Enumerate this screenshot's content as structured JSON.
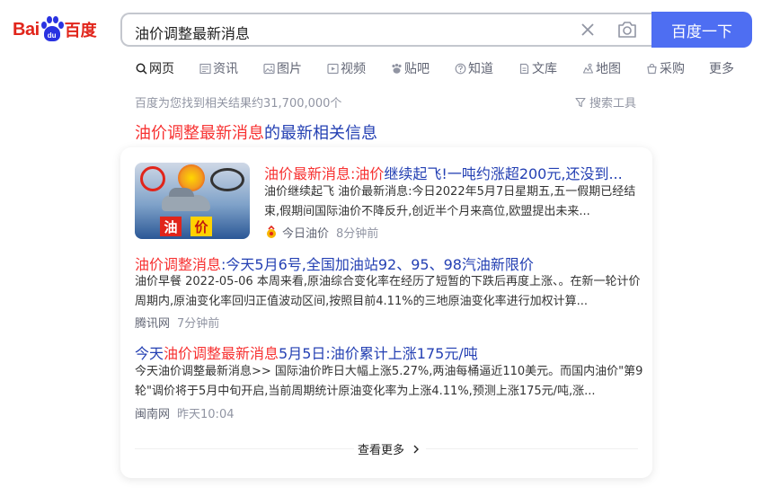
{
  "logo": {
    "bai": "Bai",
    "du": "du",
    "cn": "百度"
  },
  "search": {
    "query": "油价调整最新消息",
    "button_label": "百度一下"
  },
  "tabs": [
    {
      "label": "网页",
      "icon": "search-icon"
    },
    {
      "label": "资讯",
      "icon": "news-icon"
    },
    {
      "label": "图片",
      "icon": "image-icon"
    },
    {
      "label": "视频",
      "icon": "video-icon"
    },
    {
      "label": "贴吧",
      "icon": "tieba-icon"
    },
    {
      "label": "知道",
      "icon": "question-icon"
    },
    {
      "label": "文库",
      "icon": "document-icon"
    },
    {
      "label": "地图",
      "icon": "map-icon"
    },
    {
      "label": "采购",
      "icon": "purchase-icon"
    },
    {
      "label": "更多",
      "icon": ""
    }
  ],
  "result_count": "百度为您找到相关结果约31,700,000个",
  "search_tools": "搜索工具",
  "news_section": {
    "title_hl": "油价调整最新消息",
    "title_rest": "的最新相关信息"
  },
  "results": [
    {
      "title_hl1": "油价最新消息:油价",
      "title_rest": "继续起飞!一吨约涨超200元,还没到...",
      "desc1": "油价继续起飞 油价最新消息:今日2022年5月7日星期五,五一假期已经结",
      "desc2": "束,假期间国际油价不降反升,创近半个月来高位,欧盟提出未来...",
      "source": "今日油价",
      "time": "8分钟前",
      "thumb_chars": [
        "油",
        "价"
      ]
    },
    {
      "title_hl1": "油价调整消息",
      "title_rest": ":今天5月6号,全国加油站92、95、98汽油新限价",
      "desc1": "油价早餐 2022-05-06 本周来看,原油综合变化率在经历了短暂的下跌后再度上涨、。在新一轮计价",
      "desc2": "周期内,原油变化率回归正值波动区间,按照目前4.11%的三地原油变化率进行加权计算...",
      "source": "腾讯网",
      "time": "7分钟前"
    },
    {
      "title_pre": "今天",
      "title_hl1": "油价调整最新消息",
      "title_rest": "5月5日:油价累计上涨175元/吨",
      "desc1": "今天油价调整最新消息>> 国际油价昨日大幅上涨5.27%,两油每桶逼近110美元。而国内油价\"第9",
      "desc2": "轮\"调价将于5月中旬开启,当前周期统计原油变化率为上涨4.11%,预测上涨175元/吨,涨...",
      "source": "闽南网",
      "time": "昨天10:04"
    }
  ],
  "more_label": "查看更多",
  "colors": {
    "brand_blue": "#4e6ef2",
    "link_blue": "#2440b3",
    "highlight_red": "#f73131",
    "logo_red": "#e1251b"
  }
}
